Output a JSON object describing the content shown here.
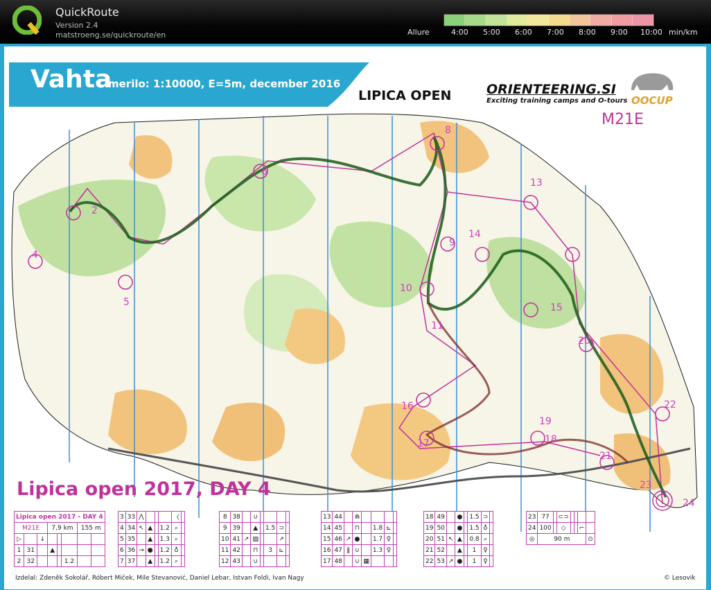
{
  "app": {
    "name": "QuickRoute",
    "version": "Version 2.4",
    "url": "matstroeng.se/quickroute/en"
  },
  "pace": {
    "label": "Allure",
    "ticks": [
      "4:00",
      "5:00",
      "6:00",
      "7:00",
      "8:00",
      "9:00",
      "10:00",
      "min/km"
    ],
    "colors": [
      "#8bd17c",
      "#a6d98a",
      "#c2e39a",
      "#e2ea9c",
      "#f2e79a",
      "#f5d98e",
      "#f3c59a",
      "#f0aca2",
      "#ef9da2",
      "#ee95a5"
    ]
  },
  "map": {
    "title": "Vahta",
    "subtitle": "merilo: 1:10000, E=5m, december 2016",
    "sponsor1": "LIPICA  OPEN",
    "sponsor2": "ORIENTEERING.SI",
    "sponsor2_sub": "Exciting training camps and O-tours",
    "sponsor3": "OOCUP",
    "class": "M21E",
    "event": "Lipica open 2017, DAY 4",
    "controls": [
      "2",
      "4",
      "5",
      "6",
      "8",
      "9",
      "10",
      "11",
      "13",
      "14",
      "15",
      "16",
      "17",
      "18",
      "19",
      "20",
      "21",
      "22",
      "23",
      "24"
    ],
    "credits": "Izdelal: Zdeněk Sokolář, Róbert Miček, Mile Stevanović, Daniel Lebar, Istvan Foldi, Ivan Nagy",
    "copyright": "© Lesovik",
    "colors": {
      "frame": "#2aa7d1",
      "magenta": "#c0329b",
      "route": "#1a5a1a"
    }
  },
  "descriptions": {
    "head": {
      "title": "Lipica open 2017  - DAY 4",
      "class": "M21E",
      "length": "7,9 km",
      "climb": "155 m"
    },
    "rows": [
      [
        "1",
        "31",
        "",
        "",
        "",
        "",
        ""
      ],
      [
        "2",
        "32",
        "",
        "",
        "",
        "1.2",
        ""
      ],
      [
        "3",
        "33",
        "",
        "",
        "",
        "",
        ""
      ],
      [
        "4",
        "34",
        "",
        "",
        "",
        "1.2",
        ""
      ],
      [
        "5",
        "35",
        "",
        "",
        "",
        "1.3",
        ""
      ],
      [
        "6",
        "36",
        "",
        "",
        "",
        "1.2",
        ""
      ],
      [
        "7",
        "37",
        "",
        "",
        "",
        "1.2",
        ""
      ],
      [
        "8",
        "38",
        "",
        "",
        "",
        "",
        ""
      ],
      [
        "9",
        "39",
        "",
        "",
        "",
        "1.5",
        ""
      ],
      [
        "10",
        "41",
        "",
        "",
        "",
        "",
        ""
      ],
      [
        "11",
        "42",
        "",
        "",
        "",
        "3",
        ""
      ],
      [
        "12",
        "43",
        "",
        "",
        "",
        "",
        ""
      ],
      [
        "13",
        "44",
        "",
        "",
        "",
        "",
        ""
      ],
      [
        "14",
        "45",
        "",
        "",
        "",
        "1.8",
        ""
      ],
      [
        "15",
        "46",
        "",
        "",
        "",
        "1.7",
        ""
      ],
      [
        "16",
        "47",
        "",
        "",
        "",
        "1.3",
        ""
      ],
      [
        "17",
        "48",
        "",
        "",
        "",
        "",
        ""
      ],
      [
        "18",
        "49",
        "",
        "",
        "",
        "1.5",
        ""
      ],
      [
        "19",
        "50",
        "",
        "",
        "",
        "1.5",
        ""
      ],
      [
        "20",
        "51",
        "",
        "",
        "",
        "0.8",
        ""
      ],
      [
        "21",
        "52",
        "",
        "",
        "",
        "1",
        ""
      ],
      [
        "22",
        "53",
        "",
        "",
        "",
        "1",
        ""
      ],
      [
        "23",
        "77",
        "",
        "",
        "",
        "",
        ""
      ],
      [
        "24",
        "100",
        "",
        "",
        "",
        "",
        ""
      ]
    ],
    "finish": "90 m"
  }
}
